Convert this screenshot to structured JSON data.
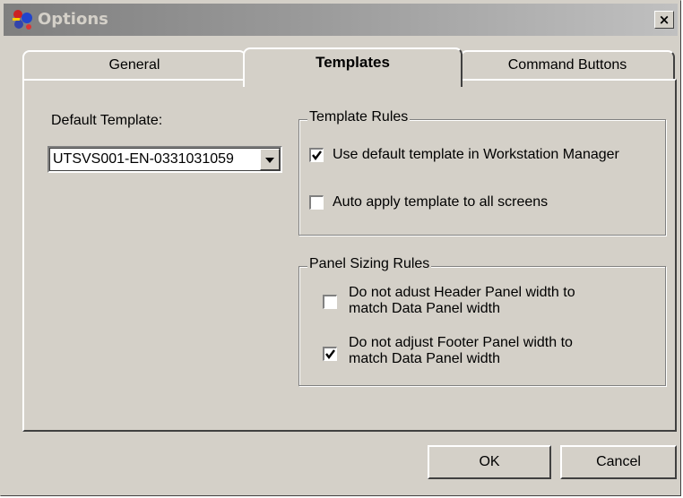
{
  "window": {
    "title": "Options",
    "icon": "options-app-icon",
    "close_glyph": "×"
  },
  "tabs": [
    {
      "label": "General",
      "active": false
    },
    {
      "label": "Templates",
      "active": true
    },
    {
      "label": "Command Buttons",
      "active": false
    }
  ],
  "templates": {
    "default_template_label": "Default Template:",
    "default_template_value": "UTSVS001-EN-0331031059",
    "template_rules": {
      "legend": "Template Rules",
      "use_default": {
        "label": "Use default template in Workstation Manager",
        "checked": true
      },
      "auto_apply": {
        "label": "Auto apply template to all screens",
        "checked": false
      }
    },
    "panel_sizing_rules": {
      "legend": "Panel Sizing Rules",
      "header_width": {
        "line1": "Do not adust Header Panel width to",
        "line2": "match Data Panel width",
        "checked": false
      },
      "footer_width": {
        "line1": "Do not adjust Footer Panel width to",
        "line2": "match Data Panel width",
        "checked": true
      }
    }
  },
  "buttons": {
    "ok": "OK",
    "cancel": "Cancel"
  },
  "colors": {
    "face": "#d4d0c8",
    "title_gradient_start": "#7f7f7f",
    "title_gradient_end": "#c0c0c0"
  }
}
